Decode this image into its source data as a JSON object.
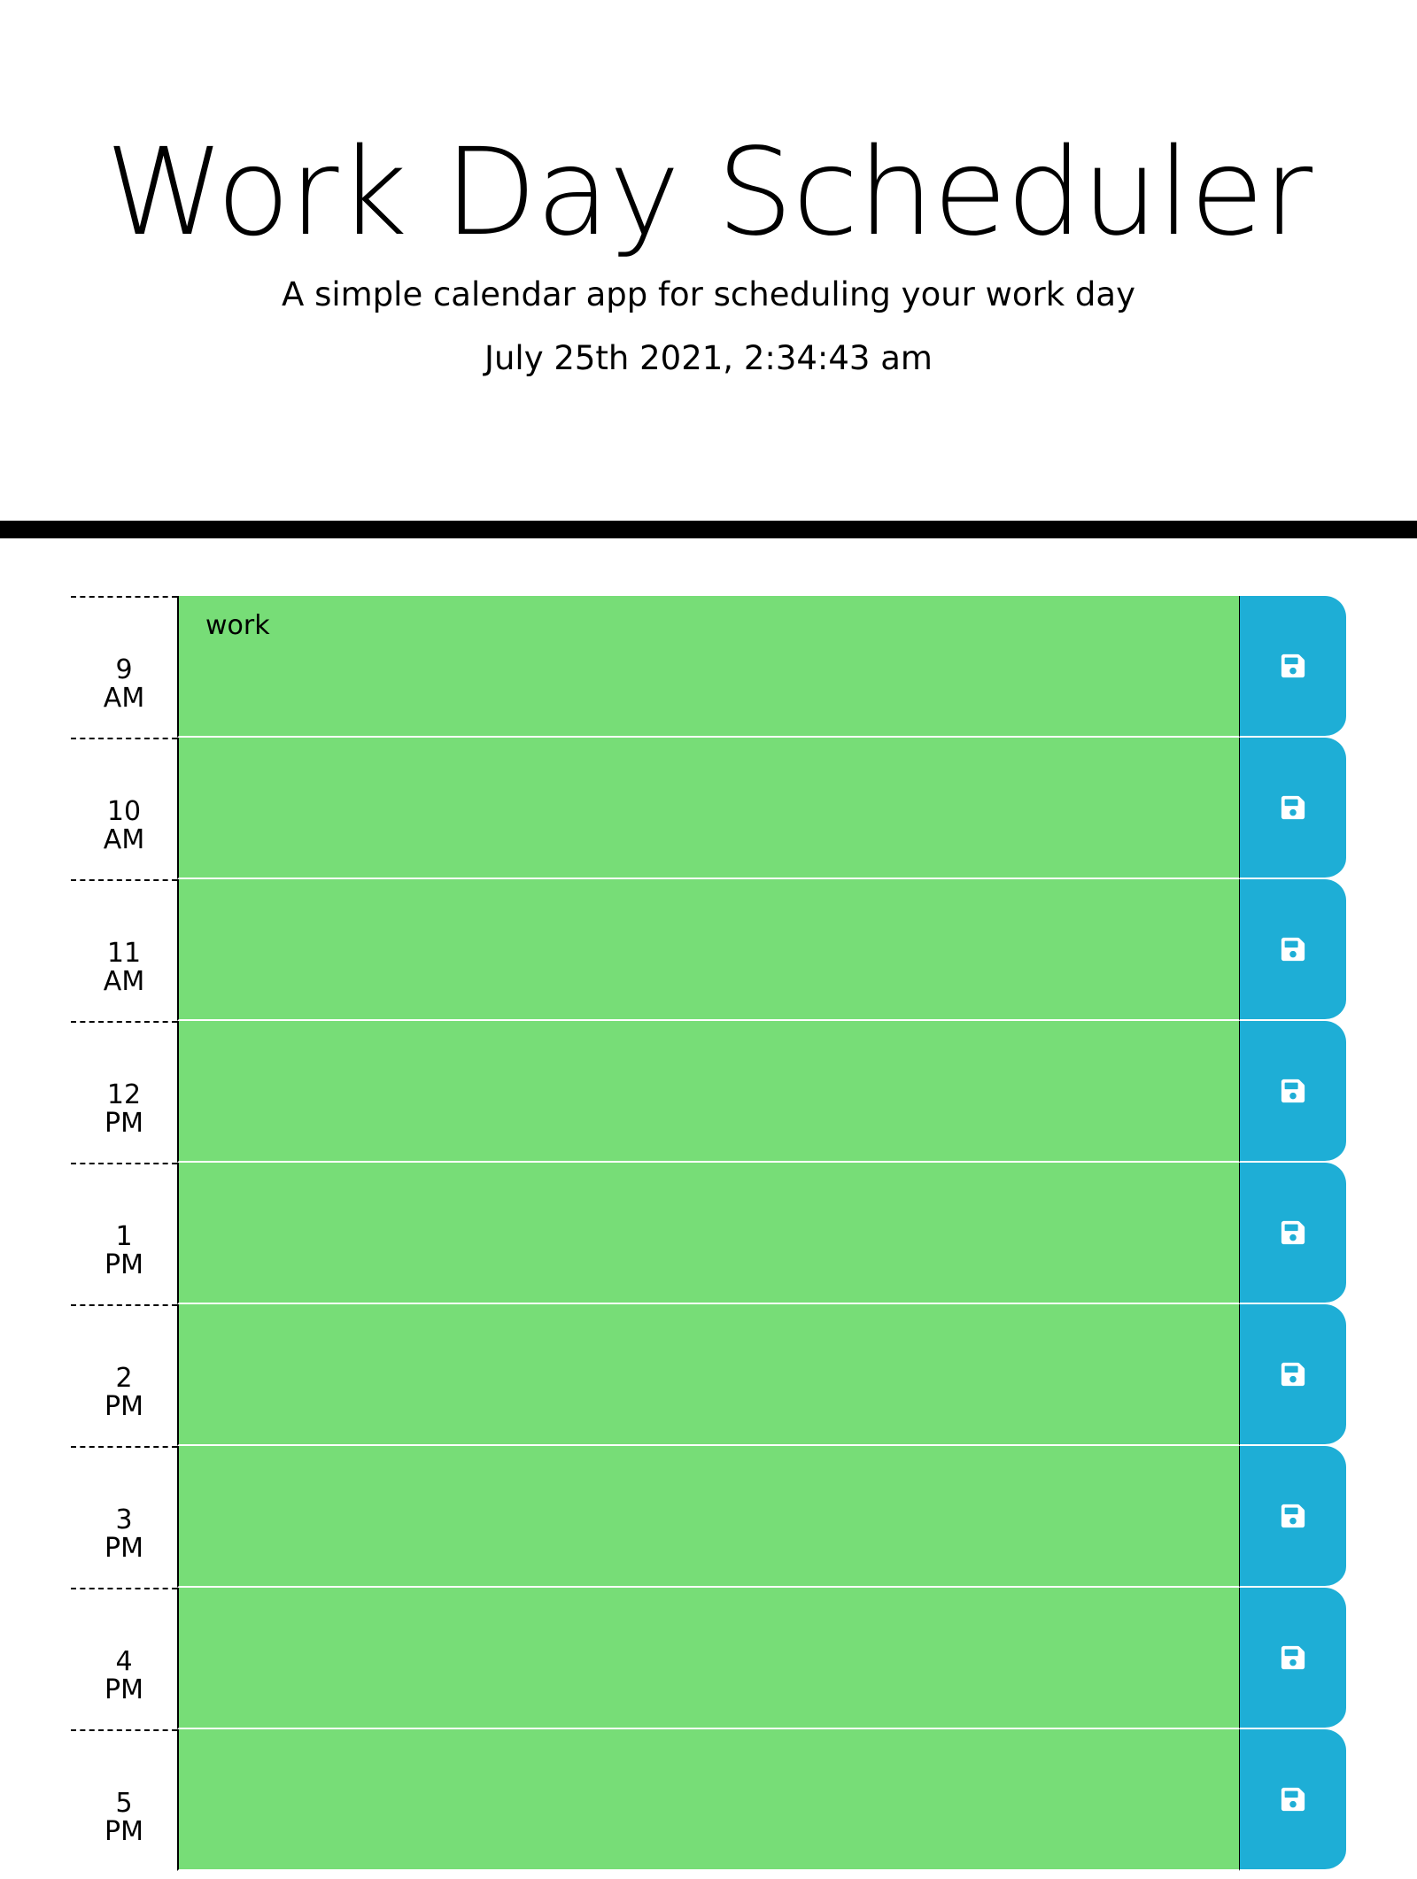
{
  "header": {
    "title": "Work Day Scheduler",
    "subtitle": "A simple calendar app for scheduling your work day",
    "current_day": "July 25th 2021, 2:34:43 am"
  },
  "colors": {
    "present_block": "#77dd77",
    "save_button": "#1eaed6",
    "divider": "#000000"
  },
  "schedule": [
    {
      "hour": "9",
      "period": "AM",
      "text": "work",
      "icon": "save-icon"
    },
    {
      "hour": "10",
      "period": "AM",
      "text": "",
      "icon": "save-icon"
    },
    {
      "hour": "11",
      "period": "AM",
      "text": "",
      "icon": "save-icon"
    },
    {
      "hour": "12",
      "period": "PM",
      "text": "",
      "icon": "save-icon"
    },
    {
      "hour": "1",
      "period": "PM",
      "text": "",
      "icon": "save-icon"
    },
    {
      "hour": "2",
      "period": "PM",
      "text": "",
      "icon": "save-icon"
    },
    {
      "hour": "3",
      "period": "PM",
      "text": "",
      "icon": "save-icon"
    },
    {
      "hour": "4",
      "period": "PM",
      "text": "",
      "icon": "save-icon"
    },
    {
      "hour": "5",
      "period": "PM",
      "text": "",
      "icon": "save-icon"
    }
  ]
}
